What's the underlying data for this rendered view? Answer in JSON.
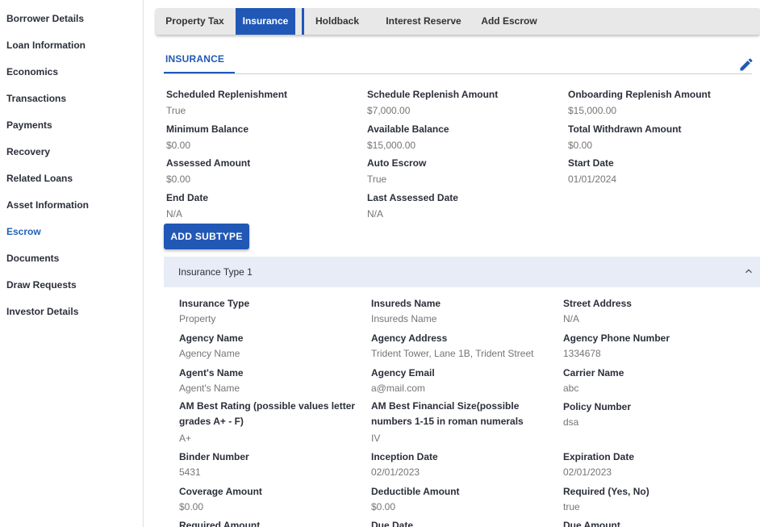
{
  "sidebar": {
    "items": [
      {
        "label": "Borrower Details"
      },
      {
        "label": "Loan Information"
      },
      {
        "label": "Economics"
      },
      {
        "label": "Transactions"
      },
      {
        "label": "Payments"
      },
      {
        "label": "Recovery"
      },
      {
        "label": "Related Loans"
      },
      {
        "label": "Asset Information"
      },
      {
        "label": "Escrow",
        "active": true
      },
      {
        "label": "Documents"
      },
      {
        "label": "Draw Requests"
      },
      {
        "label": "Investor Details"
      }
    ]
  },
  "tabs": [
    {
      "label": "Property Tax"
    },
    {
      "label": "Insurance",
      "active": true
    },
    {
      "label": "Holdback"
    },
    {
      "label": "Interest Reserve"
    },
    {
      "label": "Add Escrow"
    }
  ],
  "section": {
    "title": "INSURANCE",
    "edit_icon": "pencil-icon",
    "fields": [
      {
        "label": "Scheduled Replenishment",
        "value": "True"
      },
      {
        "label": "Schedule Replenish Amount",
        "value": "$7,000.00"
      },
      {
        "label": "Onboarding Replenish Amount",
        "value": "$15,000.00"
      },
      {
        "label": "Minimum Balance",
        "value": "$0.00"
      },
      {
        "label": "Available Balance",
        "value": "$15,000.00"
      },
      {
        "label": "Total Withdrawn Amount",
        "value": "$0.00"
      },
      {
        "label": "Assessed Amount",
        "value": "$0.00"
      },
      {
        "label": "Auto Escrow",
        "value": "True"
      },
      {
        "label": "Start Date",
        "value": "01/01/2024"
      },
      {
        "label": "End Date",
        "value": "N/A"
      },
      {
        "label": "Last Assessed Date",
        "value": "N/A"
      }
    ],
    "add_button": "ADD SUBTYPE"
  },
  "panel": {
    "title": "Insurance Type 1",
    "collapse_icon": "chevron-up-icon",
    "fields": [
      {
        "label": "Insurance Type",
        "value": "Property"
      },
      {
        "label": "Insureds Name",
        "value": "Insureds Name"
      },
      {
        "label": "Street Address",
        "value": "N/A"
      },
      {
        "label": "Agency Name",
        "value": "Agency Name"
      },
      {
        "label": "Agency Address",
        "value": "Trident Tower, Lane 1B, Trident Street"
      },
      {
        "label": "Agency Phone Number",
        "value": "1334678"
      },
      {
        "label": "Agent's Name",
        "value": "Agent's Name"
      },
      {
        "label": "Agency Email",
        "value": "a@mail.com"
      },
      {
        "label": "Carrier Name",
        "value": "abc"
      },
      {
        "label": "AM Best Rating (possible values letter grades A+ - F)",
        "value": "A+"
      },
      {
        "label": "AM Best Financial Size(possible numbers 1-15 in roman numerals",
        "value": "IV"
      },
      {
        "label": "Policy Number",
        "value": "dsa"
      },
      {
        "label": "Binder Number",
        "value": "5431"
      },
      {
        "label": "Inception Date",
        "value": "02/01/2023"
      },
      {
        "label": "Expiration Date",
        "value": "02/01/2023"
      },
      {
        "label": "Coverage Amount",
        "value": "$0.00"
      },
      {
        "label": "Deductible Amount",
        "value": "$0.00"
      },
      {
        "label": "Required (Yes, No)",
        "value": "true"
      },
      {
        "label": "Required Amount",
        "value": ""
      },
      {
        "label": "Due Date",
        "value": ""
      },
      {
        "label": "Due Amount",
        "value": ""
      }
    ]
  },
  "colors": {
    "accent": "#2158b6",
    "panel_bg": "#e7ecf6",
    "tabbar_bg": "#e8e8e8"
  }
}
